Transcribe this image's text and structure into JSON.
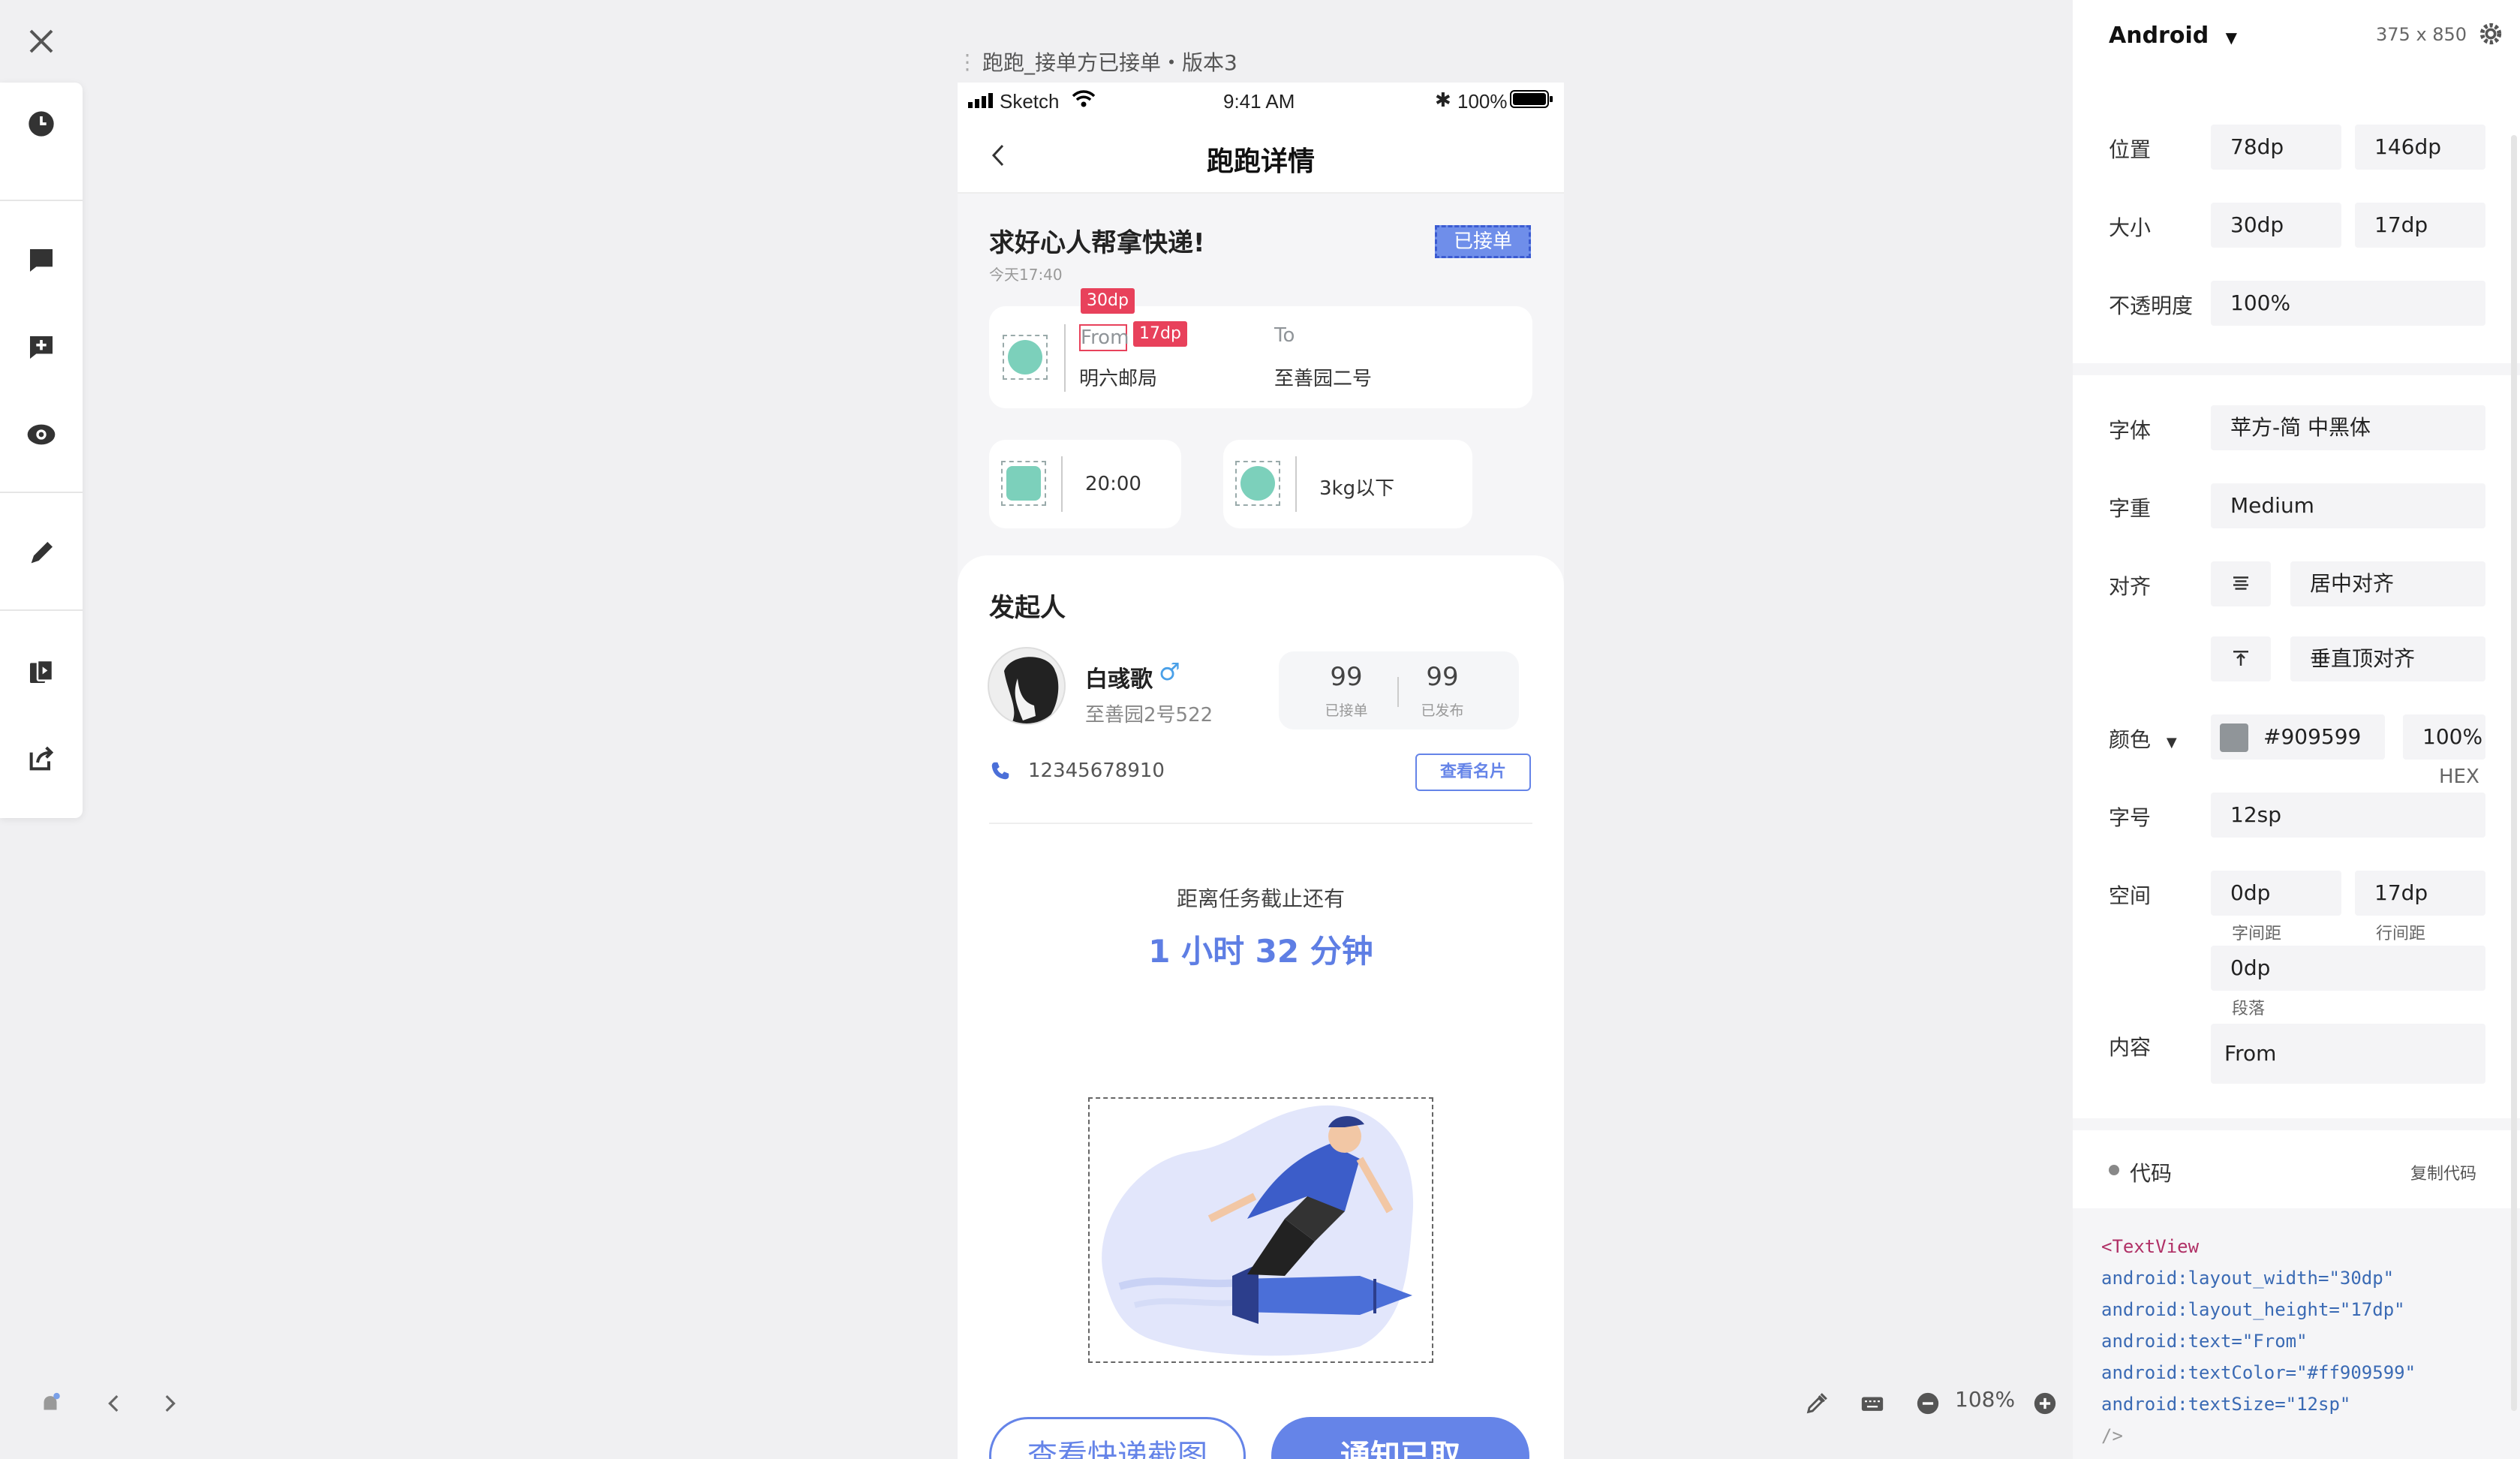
{
  "window": {
    "close_icon": "close-icon"
  },
  "left_toolbar": {
    "items": [
      {
        "icon": "history-icon"
      },
      {
        "icon": "comment-icon"
      },
      {
        "icon": "add-comment-icon"
      },
      {
        "icon": "eye-icon"
      },
      {
        "icon": "pen-icon"
      },
      {
        "icon": "slice-icon"
      },
      {
        "icon": "share-icon"
      }
    ]
  },
  "doc_title": "跑跑_接单方已接单・版本3",
  "bottom_controls": {
    "zoom": "108%"
  },
  "phone": {
    "status": {
      "carrier": "Sketch",
      "time": "9:41 AM",
      "battery": "100%"
    },
    "nav_title": "跑跑详情",
    "task_title": "求好心人帮拿快递!",
    "task_time": "今天17:40",
    "status_badge": "已接单",
    "measure_w": "30dp",
    "measure_h": "17dp",
    "from_label": "From",
    "from_value": "明六邮局",
    "to_label": "To",
    "to_value": "至善园二号",
    "time_value": "20:00",
    "weight_value": "3kg以下",
    "initiator_heading": "发起人",
    "user_name": "白彧歌",
    "gender_symbol": "♂",
    "user_address": "至善园2号522",
    "stat_accepted_num": "99",
    "stat_accepted_label": "已接单",
    "stat_posted_num": "99",
    "stat_posted_label": "已发布",
    "phone_number": "12345678910",
    "view_card": "查看名片",
    "deadline_label": "距离任务截止还有",
    "deadline_value": "1 小时 32 分钟",
    "btn_screenshot": "查看快递截图",
    "btn_notify": "通知已取"
  },
  "inspector": {
    "platform": "Android",
    "dimensions": "375 x 850",
    "position_label": "位置",
    "pos_x": "78dp",
    "pos_y": "146dp",
    "size_label": "大小",
    "size_w": "30dp",
    "size_h": "17dp",
    "opacity_label": "不透明度",
    "opacity": "100%",
    "font_label": "字体",
    "font_value": "苹方-简 中黑体",
    "weight_label": "字重",
    "weight_value": "Medium",
    "align_label": "对齐",
    "align_h": "居中对齐",
    "align_v": "垂直顶对齐",
    "color_label": "颜色",
    "color_hex": "#909599",
    "color_opacity": "100%",
    "color_mode": "HEX",
    "fontsize_label": "字号",
    "fontsize": "12sp",
    "spacing_label": "空间",
    "letter_spacing": "0dp",
    "letter_spacing_label": "字间距",
    "line_spacing": "17dp",
    "line_spacing_label": "行间距",
    "paragraph": "0dp",
    "paragraph_label": "段落",
    "content_label": "内容",
    "content": "From",
    "code_label": "代码",
    "copy_code": "复制代码",
    "code": {
      "l1": "<TextView",
      "l2a": "android:layout_width=",
      "l2b": "\"30dp\"",
      "l3a": "android:layout_height=",
      "l3b": "\"17dp\"",
      "l4a": "android:text=",
      "l4b": "\"From\"",
      "l5a": "android:textColor=",
      "l5b": "\"#ff909599\"",
      "l6a": "android:textSize=",
      "l6b": "\"12sp\"",
      "l7": "/>"
    }
  },
  "colors": {
    "accent": "#6584e8",
    "tag_red": "#e8415b",
    "green_icon": "#7cd0bb",
    "text_gray": "#909599"
  }
}
